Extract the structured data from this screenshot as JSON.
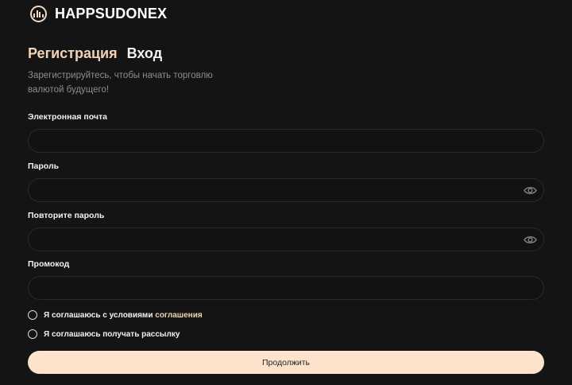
{
  "brand": {
    "name": "HAPPSUDONEX",
    "logo_icon": "bar-chart-circle-icon"
  },
  "tabs": [
    {
      "label": "Регистрация",
      "active": true
    },
    {
      "label": "Вход",
      "active": false
    }
  ],
  "subtitle": "Зарегистрируйтесь, чтобы начать торговлю валютой будущего!",
  "fields": {
    "email": {
      "label": "Электронная почта",
      "value": "",
      "placeholder": ""
    },
    "password": {
      "label": "Пароль",
      "value": "",
      "placeholder": "",
      "toggle_icon": "eye-icon"
    },
    "password_repeat": {
      "label": "Повторите пароль",
      "value": "",
      "placeholder": "",
      "toggle_icon": "eye-icon"
    },
    "promo": {
      "label": "Промокод",
      "value": "",
      "placeholder": ""
    }
  },
  "agreements": {
    "terms": {
      "prefix": "Я соглашаюсь с условиями",
      "link": "соглашения"
    },
    "newsletter": {
      "label": "Я соглашаюсь получать рассылку"
    }
  },
  "submit_label": "Продолжить",
  "colors": {
    "background": "#141414",
    "accent": "#f3d3b6",
    "button": "#fde3cc"
  }
}
